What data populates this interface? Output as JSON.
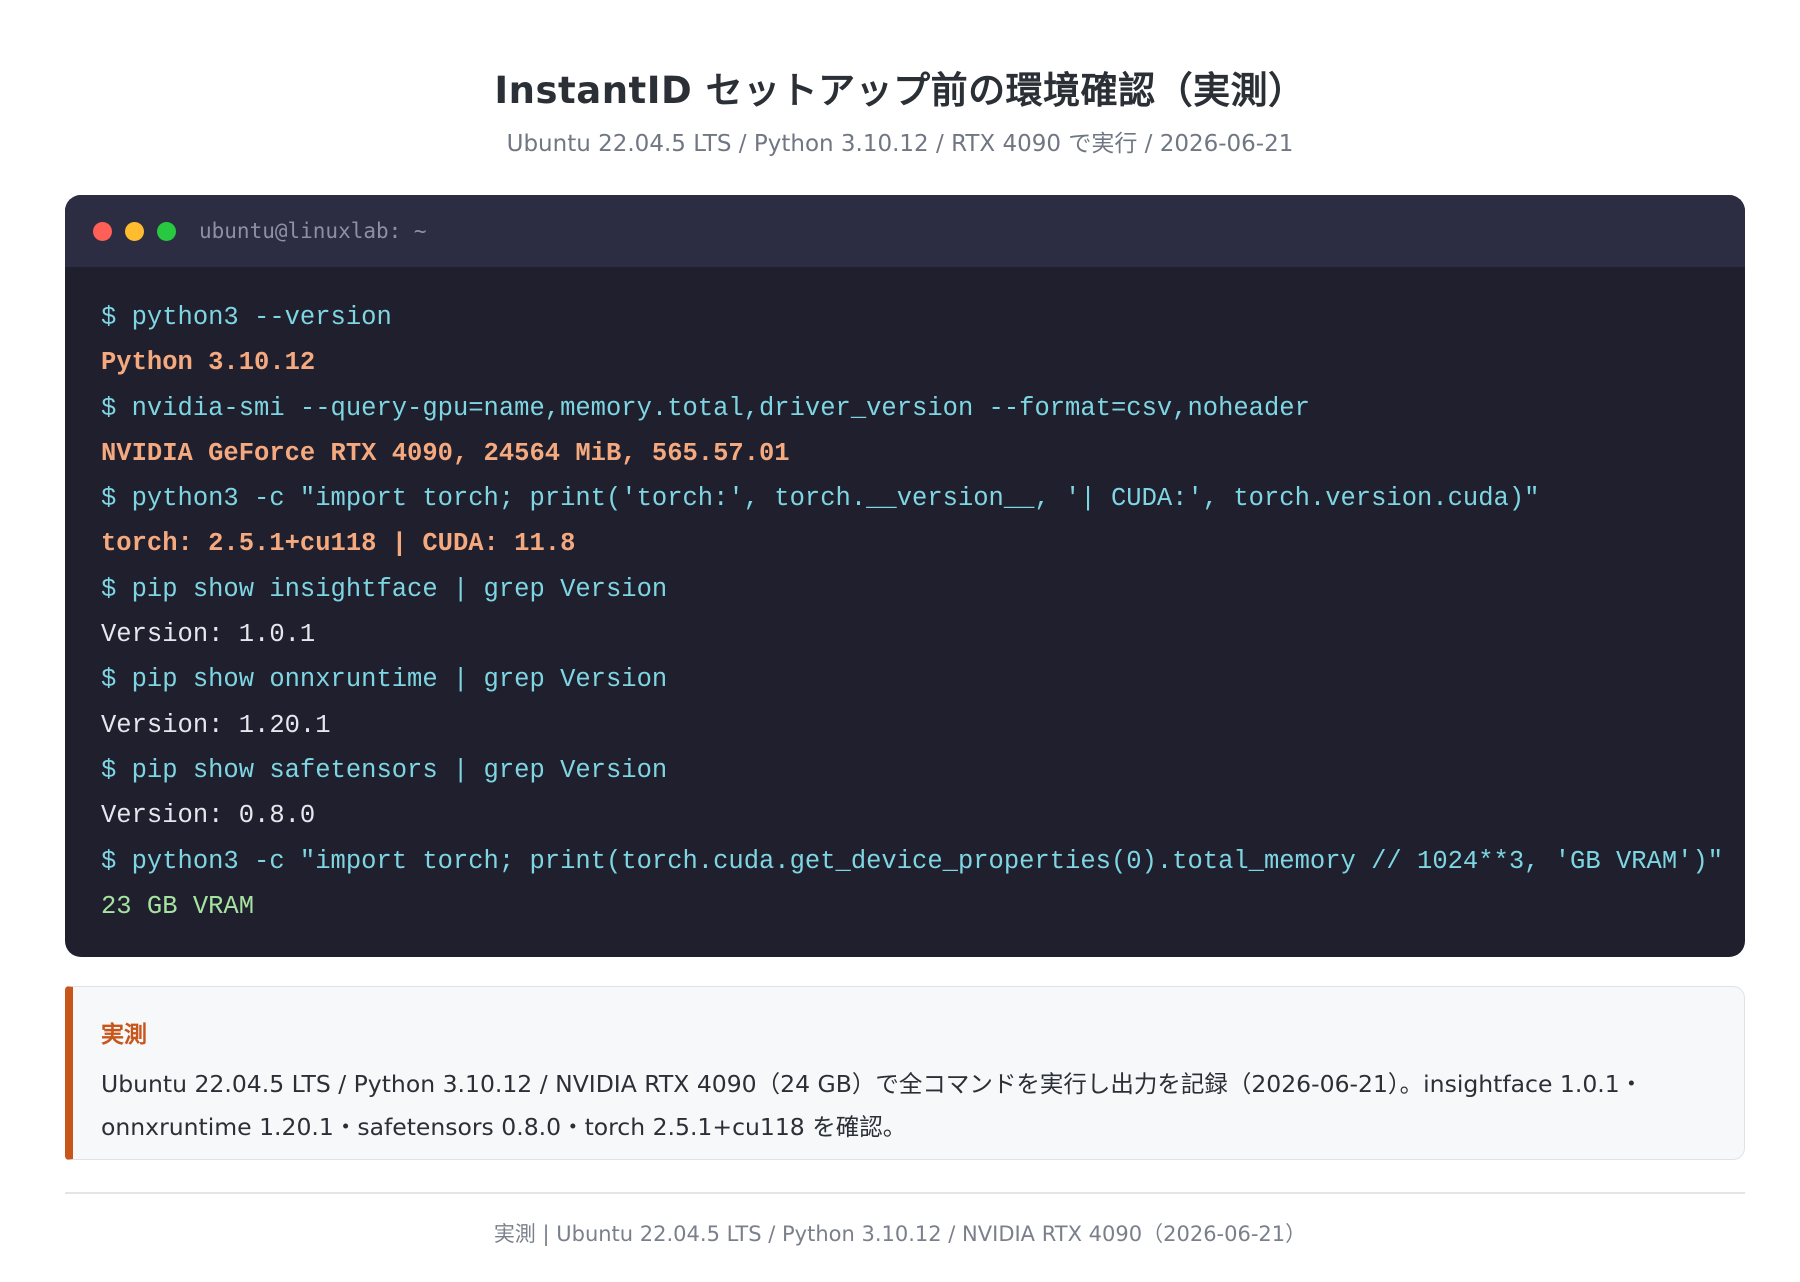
{
  "header": {
    "title": "InstantID セットアップ前の環境確認（実測）",
    "subtitle": "Ubuntu 22.04.5 LTS / Python 3.10.12 / RTX 4090 で実行 / 2026-06-21"
  },
  "terminal": {
    "title": "ubuntu@linuxlab: ~",
    "lines": [
      {
        "kind": "cmd",
        "text": "$ python3 --version"
      },
      {
        "kind": "out-strong",
        "text": "Python 3.10.12"
      },
      {
        "kind": "cmd",
        "text": "$ nvidia-smi --query-gpu=name,memory.total,driver_version --format=csv,noheader"
      },
      {
        "kind": "out-strong",
        "text": "NVIDIA GeForce RTX 4090, 24564 MiB, 565.57.01"
      },
      {
        "kind": "cmd",
        "text": "$ python3 -c \"import torch; print('torch:', torch.__version__, '| CUDA:', torch.version.cuda)\""
      },
      {
        "kind": "out-strong",
        "text": "torch: 2.5.1+cu118 | CUDA: 11.8"
      },
      {
        "kind": "cmd",
        "text": "$ pip show insightface | grep Version"
      },
      {
        "kind": "out",
        "text": "Version: 1.0.1"
      },
      {
        "kind": "cmd",
        "text": "$ pip show onnxruntime | grep Version"
      },
      {
        "kind": "out",
        "text": "Version: 1.20.1"
      },
      {
        "kind": "cmd",
        "text": "$ pip show safetensors | grep Version"
      },
      {
        "kind": "out",
        "text": "Version: 0.8.0"
      },
      {
        "kind": "cmd",
        "text": "$ python3 -c \"import torch; print(torch.cuda.get_device_properties(0).total_memory // 1024**3, 'GB VRAM')\""
      },
      {
        "kind": "out-green",
        "text": "23 GB VRAM"
      }
    ]
  },
  "note": {
    "title": "実測",
    "text": "Ubuntu 22.04.5 LTS / Python 3.10.12 / NVIDIA RTX 4090（24 GB）で全コマンドを実行し出力を記録（2026-06-21）。insightface 1.0.1・onnxruntime 1.20.1・safetensors 0.8.0・torch 2.5.1+cu118 を確認。"
  },
  "footer": {
    "text": "実測 | Ubuntu 22.04.5 LTS / Python 3.10.12 / NVIDIA RTX 4090（2026-06-21）"
  }
}
